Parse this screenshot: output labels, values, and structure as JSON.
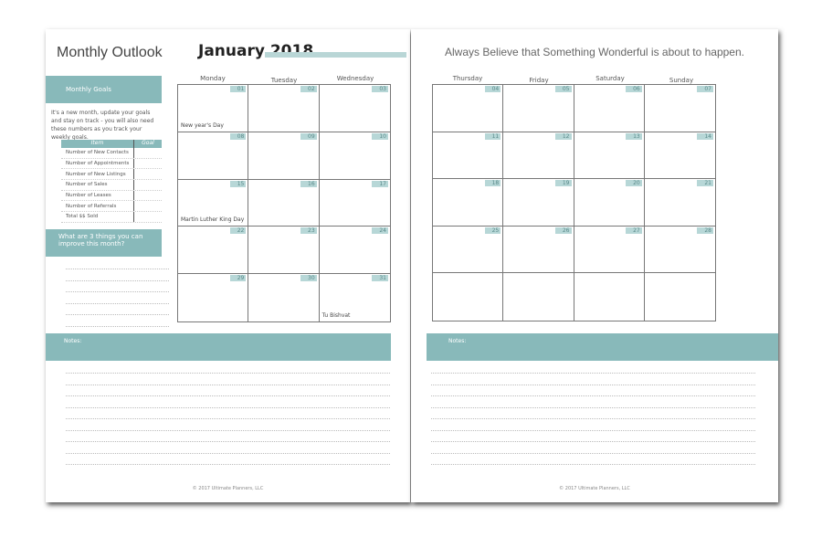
{
  "left": {
    "title": "Monthly Outlook",
    "month": "January 2018",
    "goals_header": "Monthly Goals",
    "goals_intro": "It's a new month, update your goals and stay on track - you will also need these numbers as you track your weekly goals.",
    "table_headers": [
      "Item",
      "Goal"
    ],
    "items": [
      "Number of New Contacts",
      "Number of Appointments",
      "Number of New Listings",
      "Number of Sales",
      "Number of Leases",
      "Number of Referrals",
      "Total $$ Sold"
    ],
    "improve": "What are 3 things you can improve this month?",
    "days": [
      "Monday",
      "Tuesday",
      "Wednesday"
    ],
    "dates": [
      "01",
      "02",
      "03",
      "08",
      "09",
      "10",
      "15",
      "16",
      "17",
      "22",
      "23",
      "24",
      "29",
      "30",
      "31"
    ],
    "events": {
      "0": "New year's Day",
      "6": "Martin Luther King Day",
      "14": "Tu Bishvat"
    },
    "notes": "Notes:",
    "footer": "© 2017 Ultimate Planners, LLC"
  },
  "right": {
    "quote": "Always Believe that Something Wonderful is about to happen.",
    "days": [
      "Thursday",
      "Friday",
      "Saturday",
      "Sunday"
    ],
    "dates": [
      "04",
      "05",
      "06",
      "07",
      "11",
      "12",
      "13",
      "14",
      "18",
      "19",
      "20",
      "21",
      "25",
      "26",
      "27",
      "28",
      "",
      "",
      "",
      ""
    ],
    "notes": "Notes:",
    "footer": "© 2017 Ultimate Planners, LLC"
  },
  "colors": {
    "accent": "#88b9ba"
  }
}
